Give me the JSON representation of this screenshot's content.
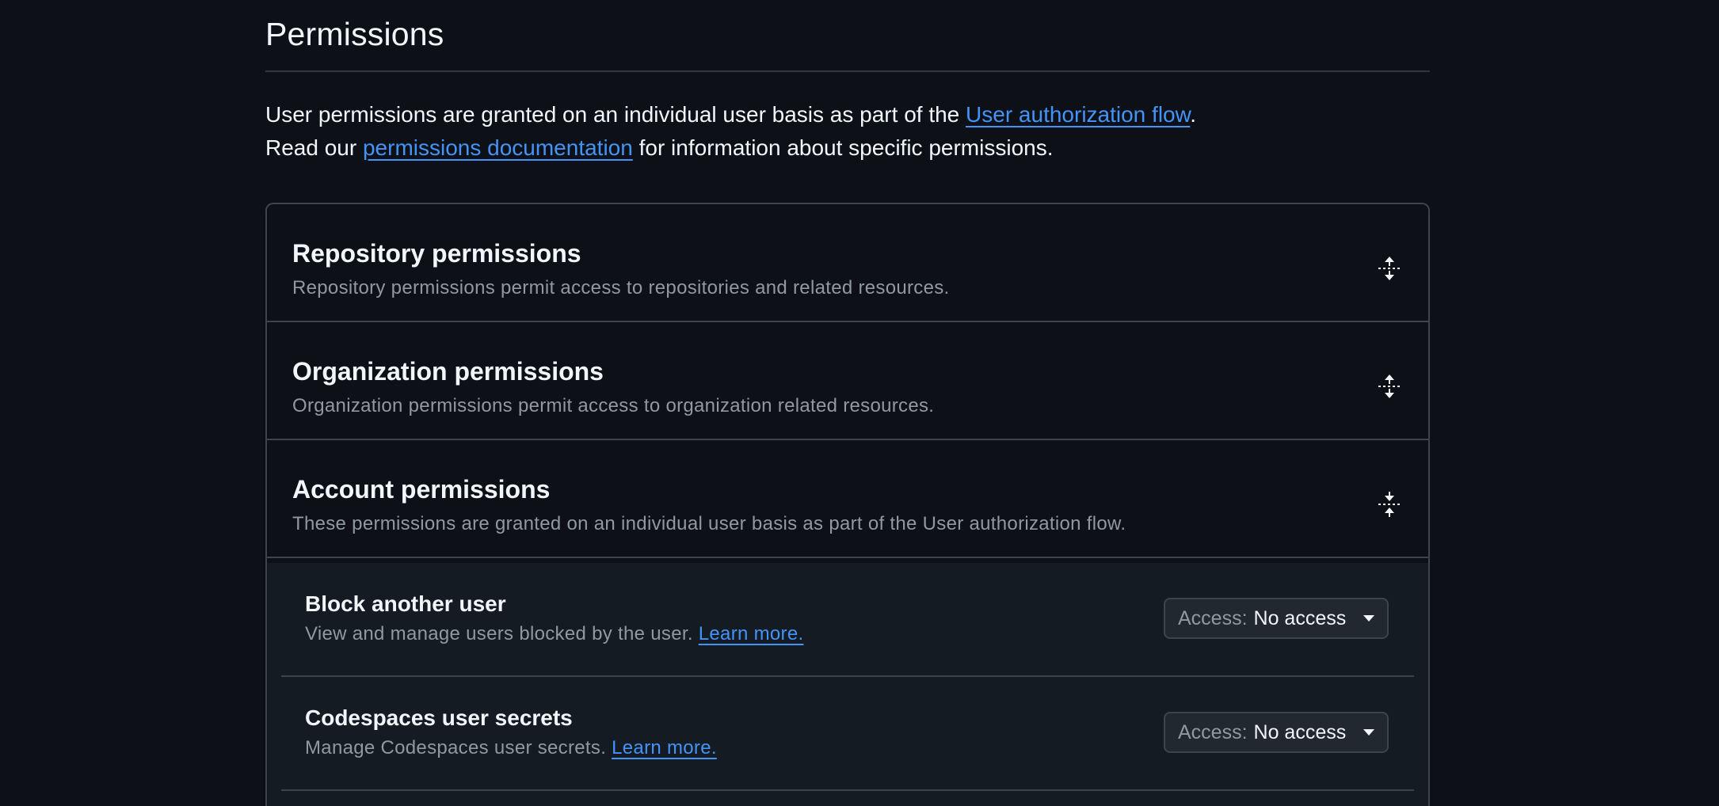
{
  "header": {
    "title": "Permissions"
  },
  "intro": {
    "line1_prefix": "User permissions are granted on an individual user basis as part of the ",
    "line1_link": "User authorization flow",
    "line1_suffix": ".",
    "line2_prefix": "Read our ",
    "line2_link": "permissions documentation",
    "line2_suffix": " for information about specific permissions."
  },
  "sections": [
    {
      "title": "Repository permissions",
      "description": "Repository permissions permit access to repositories and related resources.",
      "icon": "unfold-icon"
    },
    {
      "title": "Organization permissions",
      "description": "Organization permissions permit access to organization related resources.",
      "icon": "unfold-icon"
    },
    {
      "title": "Account permissions",
      "description": "These permissions are granted on an individual user basis as part of the User authorization flow.",
      "icon": "fold-icon"
    }
  ],
  "account_permissions": [
    {
      "title": "Block another user",
      "description": "View and manage users blocked by the user. ",
      "link": "Learn more.",
      "access_label": "Access:",
      "access_value": "No access"
    },
    {
      "title": "Codespaces user secrets",
      "description": "Manage Codespaces user secrets. ",
      "link": "Learn more.",
      "access_label": "Access:",
      "access_value": "No access"
    }
  ],
  "colors": {
    "background": "#0d1117",
    "link": "#4493f8",
    "border": "#3d444d",
    "muted_text": "#9198a1"
  }
}
